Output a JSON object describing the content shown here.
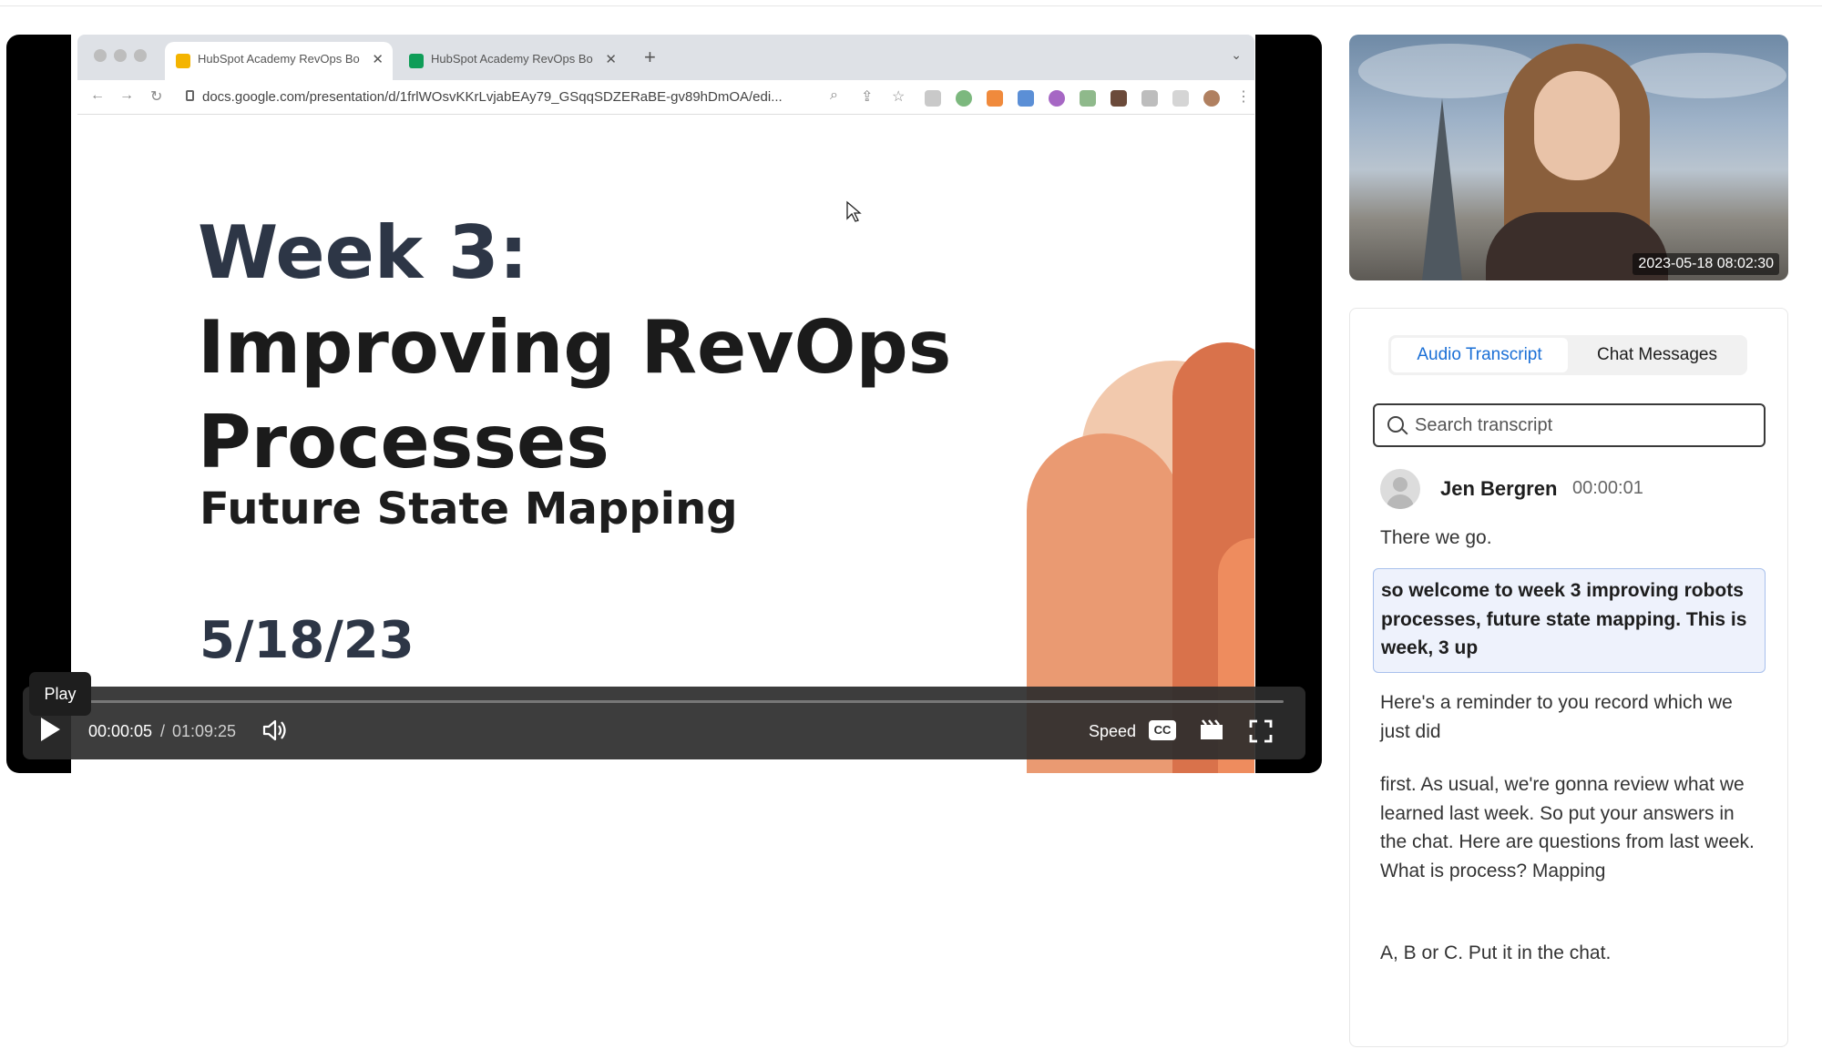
{
  "browser": {
    "tabs": [
      {
        "title": "HubSpot Academy RevOps Bo",
        "favicon_color": "#f4b400"
      },
      {
        "title": "HubSpot Academy RevOps Bo",
        "favicon_color": "#0f9d58"
      }
    ],
    "url": "docs.google.com/presentation/d/1frlWOsvKKrLvjabEAy79_GSqqSDZERaBE-gv89hDmOA/edi..."
  },
  "slide": {
    "title_line1": "Week 3:",
    "title_line2": "Improving RevOps",
    "title_line3": "Processes",
    "subtitle": "Future State Mapping",
    "date": "5/18/23",
    "accent_colors": [
      "#f2c9ad",
      "#ea9a72",
      "#d9724b",
      "#c9583a"
    ]
  },
  "player": {
    "tooltip": "Play",
    "current_time": "00:00:05",
    "separator": "/",
    "total_time": "01:09:25",
    "progress_fraction": 0.0012,
    "speed_label": "Speed",
    "cc_label": "CC"
  },
  "webcam": {
    "timestamp": "2023-05-18  08:02:30"
  },
  "transcript_panel": {
    "tabs": [
      "Audio Transcript",
      "Chat Messages"
    ],
    "active_tab": "Audio Transcript",
    "search_placeholder": "Search transcript",
    "speaker": "Jen Bergren",
    "speaker_time": "00:00:01",
    "lines": [
      "There we go.",
      "so welcome to week 3 improving robots processes, future state mapping. This is week, 3 up",
      "Here's a reminder to you record which we just did",
      "first. As usual, we're gonna review what we learned last week. So put your answers in the chat. Here are questions from last week. What is process? Mapping",
      "A, B or C. Put it in the chat."
    ],
    "highlighted_line_index": 1
  },
  "colors": {
    "accent_blue": "#1a6fd6",
    "highlight_bg": "#eef2fc",
    "highlight_border": "#a8c0ec"
  }
}
